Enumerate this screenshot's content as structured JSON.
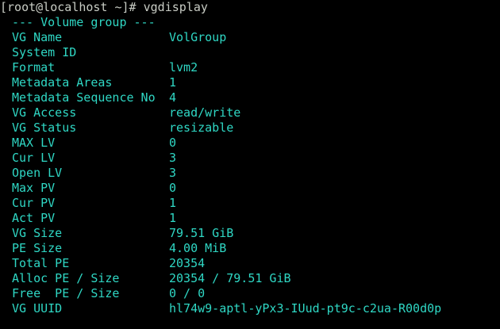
{
  "terminal": {
    "prompt": "[root@localhost ~]#",
    "command": "vgdisplay",
    "section_header": "--- Volume group ---",
    "fields": [
      {
        "label": "VG Name",
        "value": "VolGroup"
      },
      {
        "label": "System ID",
        "value": ""
      },
      {
        "label": "Format",
        "value": "lvm2"
      },
      {
        "label": "Metadata Areas",
        "value": "1"
      },
      {
        "label": "Metadata Sequence No",
        "value": "4"
      },
      {
        "label": "VG Access",
        "value": "read/write"
      },
      {
        "label": "VG Status",
        "value": "resizable"
      },
      {
        "label": "MAX LV",
        "value": "0"
      },
      {
        "label": "Cur LV",
        "value": "3"
      },
      {
        "label": "Open LV",
        "value": "3"
      },
      {
        "label": "Max PV",
        "value": "0"
      },
      {
        "label": "Cur PV",
        "value": "1"
      },
      {
        "label": "Act PV",
        "value": "1"
      },
      {
        "label": "VG Size",
        "value": "79.51 GiB"
      },
      {
        "label": "PE Size",
        "value": "4.00 MiB"
      },
      {
        "label": "Total PE",
        "value": "20354"
      },
      {
        "label": "Alloc PE / Size",
        "value": "20354 / 79.51 GiB"
      },
      {
        "label": "Free  PE / Size",
        "value": "0 / 0"
      },
      {
        "label": "VG UUID",
        "value": "hl74w9-aptl-yPx3-IUud-pt9c-c2ua-R00d0p"
      }
    ]
  },
  "colors": {
    "background": "#000000",
    "prompt_text": "#c8ccc4",
    "output_text": "#2fd7c4"
  }
}
